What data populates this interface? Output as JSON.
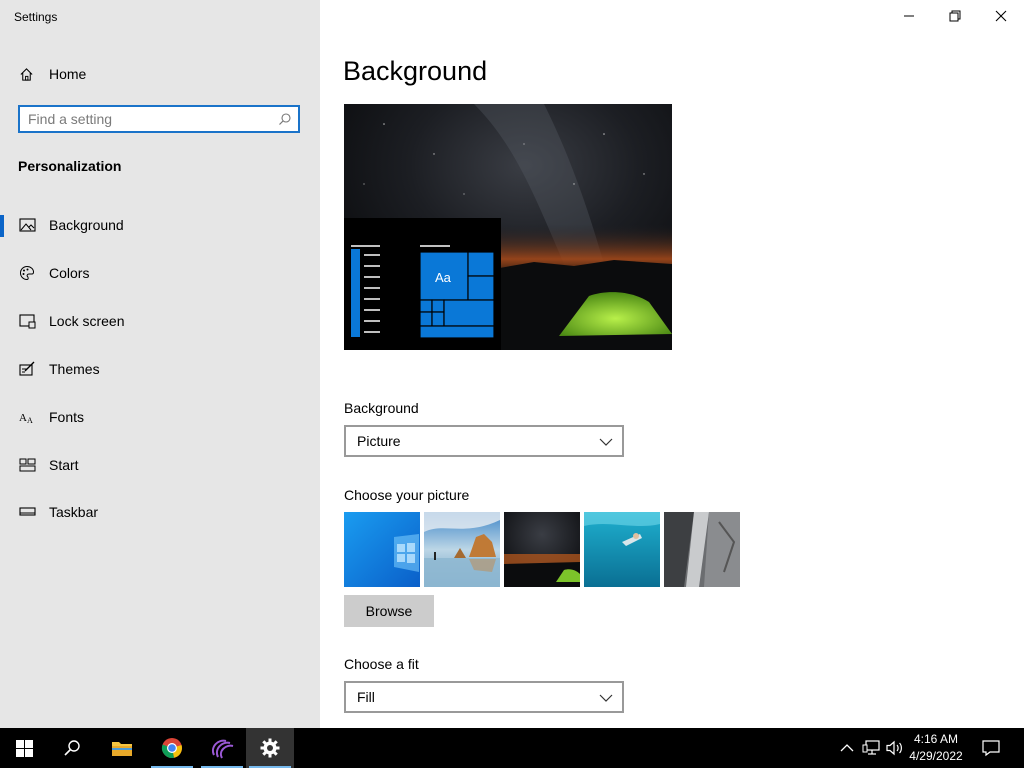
{
  "window": {
    "title": "Settings",
    "controls": {
      "minimize": "minimize",
      "restore": "restore",
      "close": "close"
    }
  },
  "sidebar": {
    "home_label": "Home",
    "search": {
      "placeholder": "Find a setting",
      "value": ""
    },
    "section_title": "Personalization",
    "items": [
      {
        "label": "Background",
        "icon": "picture-icon",
        "selected": true
      },
      {
        "label": "Colors",
        "icon": "palette-icon",
        "selected": false
      },
      {
        "label": "Lock screen",
        "icon": "lock-screen-icon",
        "selected": false
      },
      {
        "label": "Themes",
        "icon": "themes-icon",
        "selected": false
      },
      {
        "label": "Fonts",
        "icon": "fonts-icon",
        "selected": false
      },
      {
        "label": "Start",
        "icon": "start-icon",
        "selected": false
      },
      {
        "label": "Taskbar",
        "icon": "taskbar-icon",
        "selected": false
      }
    ]
  },
  "main": {
    "title": "Background",
    "preview": {
      "tile_label": "Aa"
    },
    "background_label": "Background",
    "background_value": "Picture",
    "choose_picture_label": "Choose your picture",
    "browse_label": "Browse",
    "choose_fit_label": "Choose a fit",
    "fit_value": "Fill"
  },
  "taskbar": {
    "apps": [
      "start-icon",
      "search-icon",
      "file-explorer-icon",
      "chrome-icon",
      "purple-app-icon",
      "settings-icon"
    ],
    "time": "4:16 AM",
    "date": "4/29/2022"
  },
  "colors": {
    "accent": "#0078d7",
    "sidebar_bg": "#e6e6e6",
    "taskbar_bg": "#000000"
  }
}
